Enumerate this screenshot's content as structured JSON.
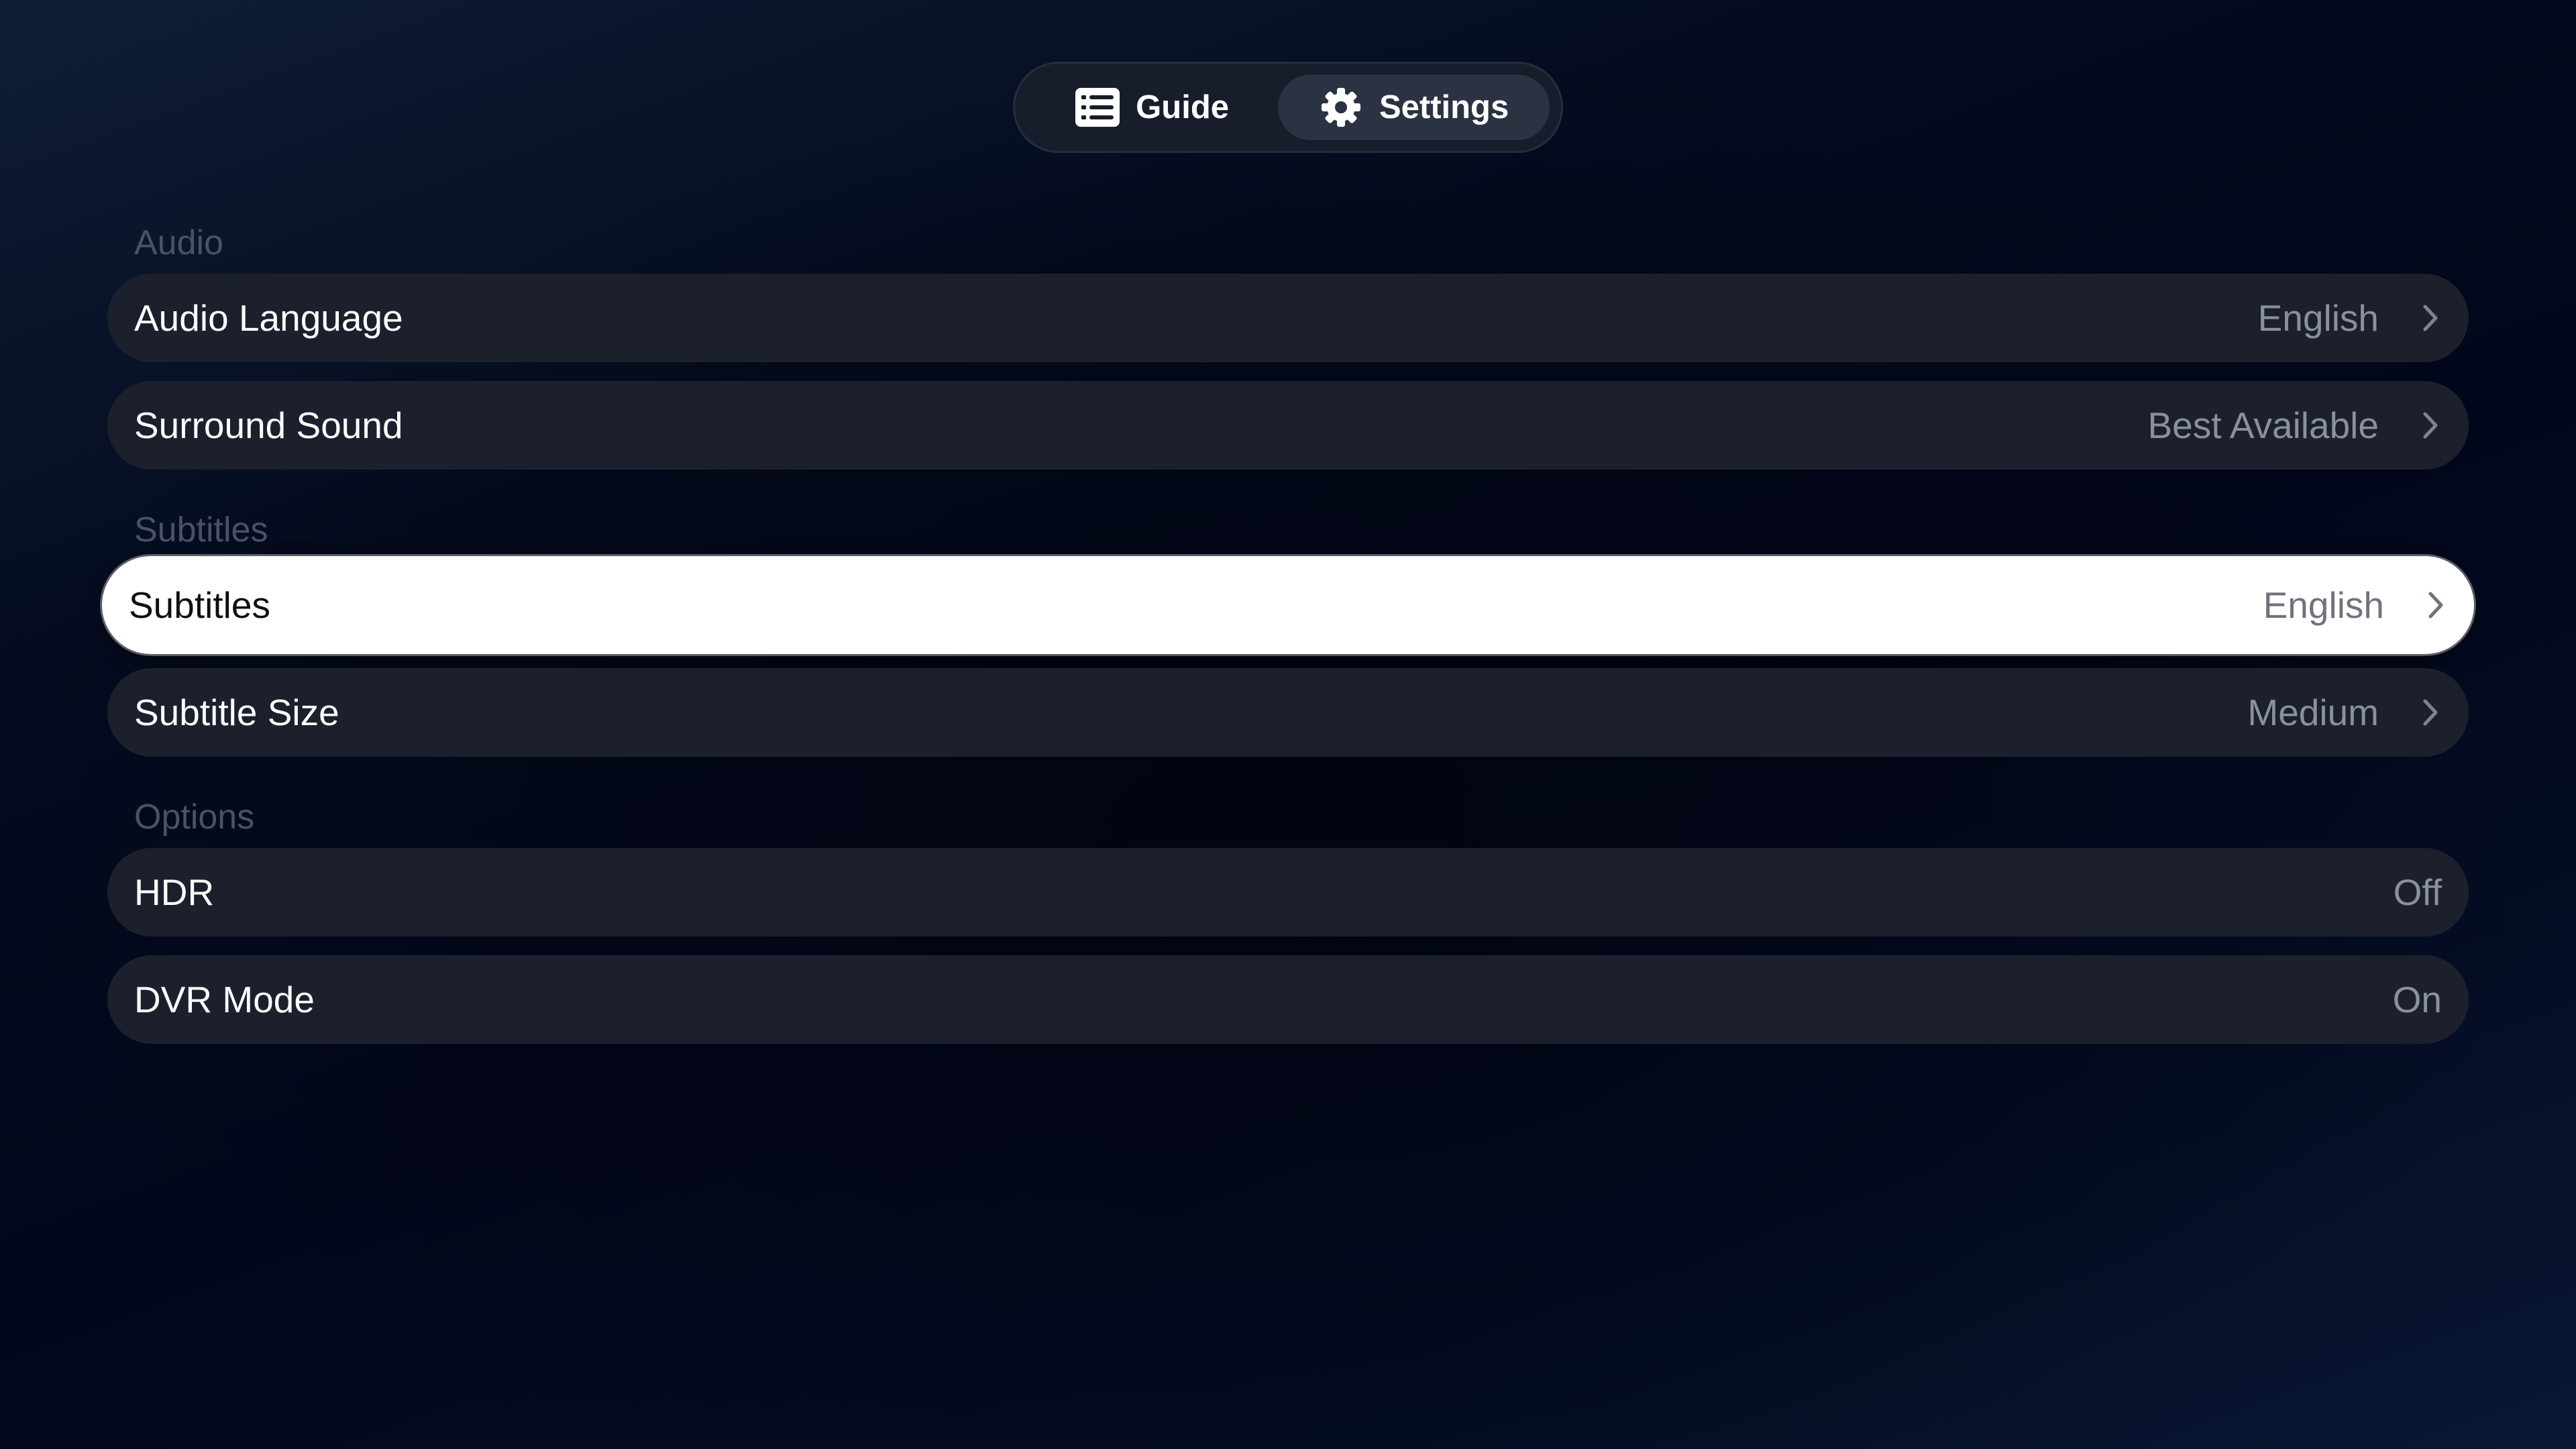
{
  "topbar": {
    "guide_label": "Guide",
    "guide_icon": "list-icon",
    "settings_label": "Settings",
    "settings_icon": "gear-icon",
    "selected": "Settings"
  },
  "sections": {
    "audio": {
      "title": "Audio",
      "rows": [
        {
          "label": "Audio Language",
          "value": "English"
        },
        {
          "label": "Surround Sound",
          "value": "Best Available"
        }
      ]
    },
    "subtitles": {
      "title": "Subtitles",
      "rows": [
        {
          "label": "Subtitles",
          "value": "English",
          "focused": true
        },
        {
          "label": "Subtitle Size",
          "value": "Medium"
        }
      ]
    },
    "options": {
      "title": "Options",
      "rows": [
        {
          "label": "HDR",
          "value": "Off"
        },
        {
          "label": "DVR Mode",
          "value": "On"
        }
      ]
    }
  },
  "colors": {
    "row_background": "#1b202c",
    "focused_background": "#ffffff",
    "section_label": "#4a5263",
    "value_text": "#8a909d",
    "chevron": "#7d838f"
  }
}
